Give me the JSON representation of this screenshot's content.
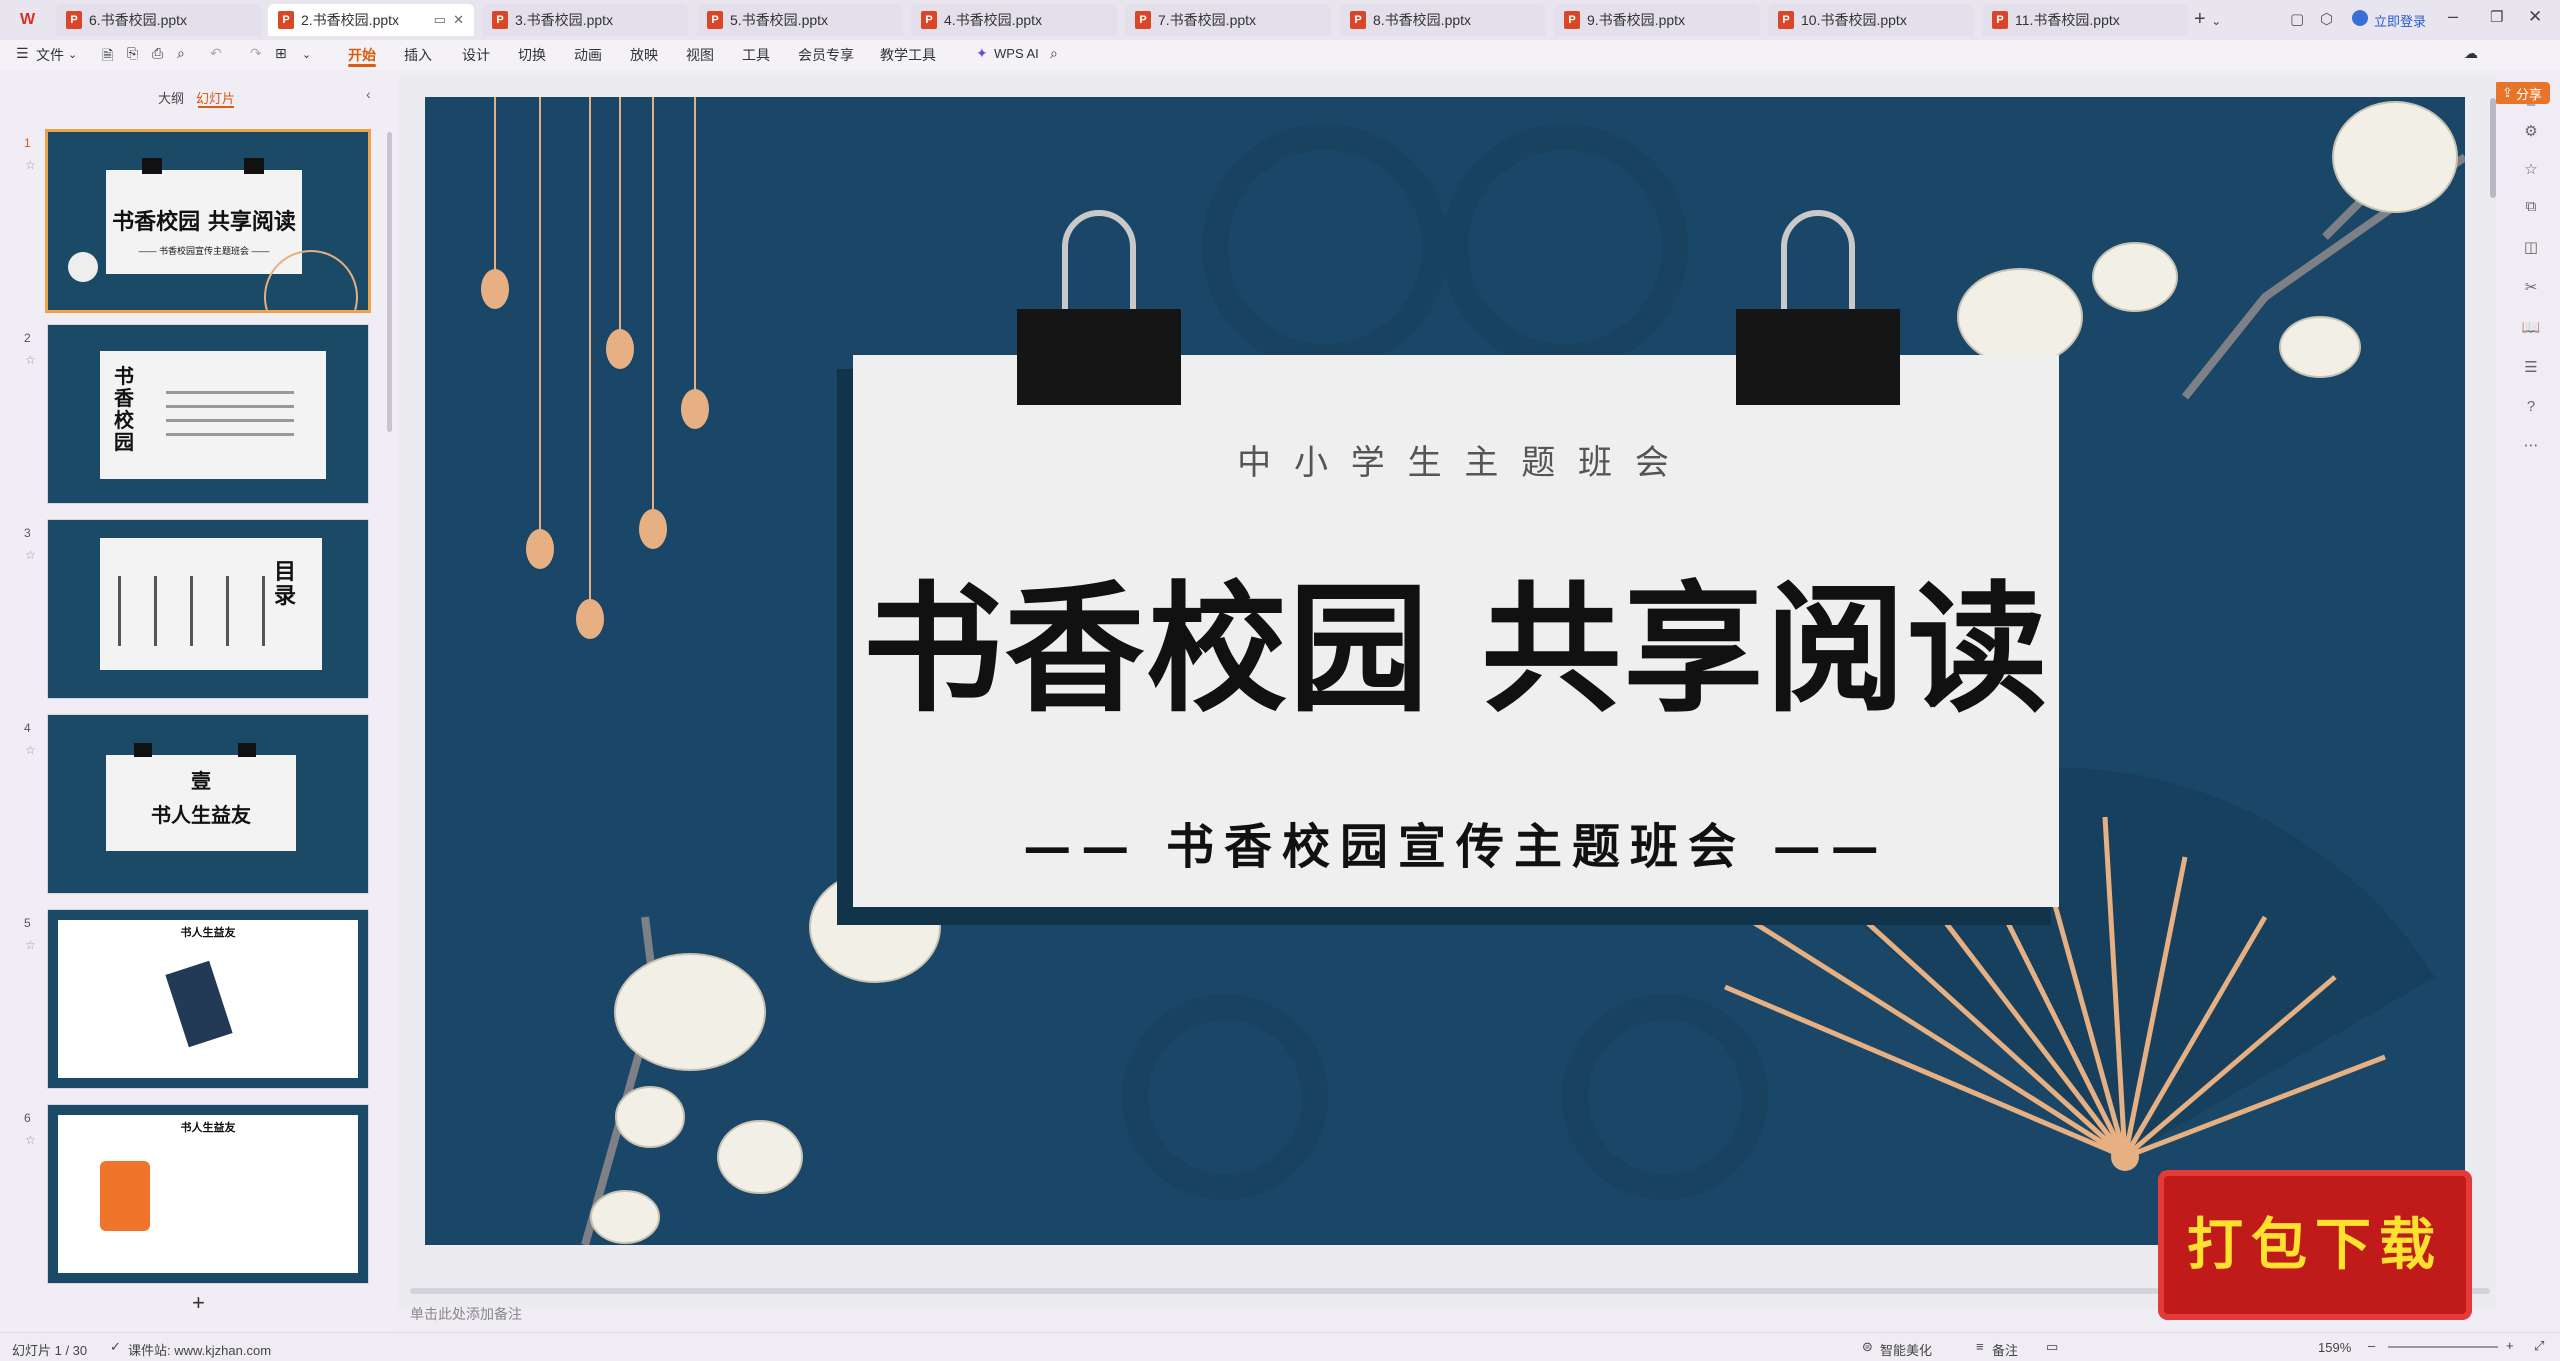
{
  "tabs": [
    {
      "label": "6.书香校园.pptx"
    },
    {
      "label": "2.书香校园.pptx"
    },
    {
      "label": "3.书香校园.pptx"
    },
    {
      "label": "5.书香校园.pptx"
    },
    {
      "label": "4.书香校园.pptx"
    },
    {
      "label": "7.书香校园.pptx"
    },
    {
      "label": "8.书香校园.pptx"
    },
    {
      "label": "9.书香校园.pptx"
    },
    {
      "label": "10.书香校园.pptx"
    },
    {
      "label": "11.书香校园.pptx"
    }
  ],
  "account": {
    "login": "立即登录"
  },
  "menu": {
    "file": "文件",
    "items": [
      "开始",
      "插入",
      "设计",
      "切换",
      "动画",
      "放映",
      "视图",
      "工具",
      "会员专享",
      "教学工具"
    ],
    "wps_ai": "WPS AI",
    "share": "分享"
  },
  "panel": {
    "tab_outline": "大纲",
    "tab_slides": "幻灯片",
    "add": "+"
  },
  "thumbs": [
    {
      "num": "1",
      "title": "书香校园 共享阅读",
      "sub": "—— 书香校园宣传主题班会 ——"
    },
    {
      "num": "2",
      "title": "书香校园"
    },
    {
      "num": "3",
      "title": "目录"
    },
    {
      "num": "4",
      "title": "壹",
      "sub": "书人生益友"
    },
    {
      "num": "5",
      "title": "书人生益友"
    },
    {
      "num": "6",
      "title": "书人生益友"
    }
  ],
  "slide": {
    "kicker": "中 小 学 生 主 题 班 会",
    "title": "书香校园 共享阅读",
    "subtitle": "—— 书香校园宣传主题班会 ——"
  },
  "notes": "单击此处添加备注",
  "status": {
    "slide_counter": "幻灯片 1 / 30",
    "site": "课件站: www.kjzhan.com",
    "beautify": "智能美化",
    "notes_btn": "备注",
    "zoom": "159%"
  },
  "promo": "打包下载",
  "colors": {
    "accent": "#d95c10",
    "slide_bg": "#1a4767",
    "fan": "#e7b083"
  }
}
